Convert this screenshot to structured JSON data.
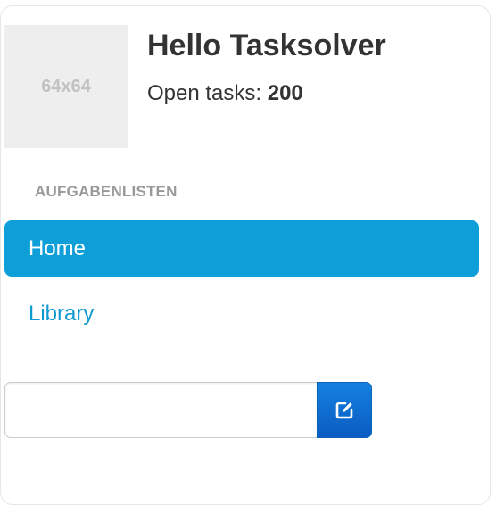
{
  "avatar": {
    "placeholder_text": "64x64"
  },
  "header": {
    "greeting": "Hello Tasksolver",
    "open_tasks_label": "Open tasks: ",
    "open_tasks_count": "200"
  },
  "sidebar": {
    "section_title": "AUFGABENLISTEN",
    "items": [
      {
        "label": "Home",
        "active": true
      },
      {
        "label": "Library",
        "active": false
      }
    ]
  },
  "new_list": {
    "input_value": "",
    "button_icon": "edit-icon"
  },
  "colors": {
    "accent": "#0f9fd8",
    "link": "#0f9ad0",
    "button": "#0a5cc2"
  }
}
